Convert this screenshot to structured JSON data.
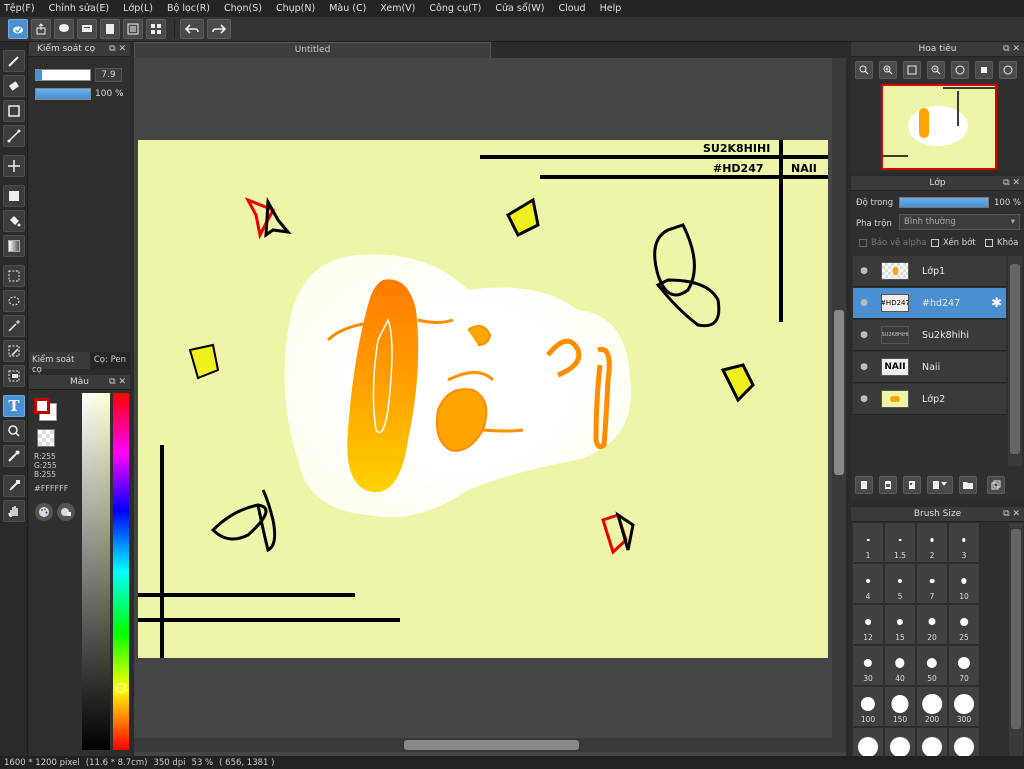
{
  "menu": [
    "Tệp(F)",
    "Chỉnh sửa(E)",
    "Lớp(L)",
    "Bộ lọc(R)",
    "Chọn(S)",
    "Chụp(N)",
    "Màu (C)",
    "Xem(V)",
    "Công cụ(T)",
    "Cửa sổ(W)",
    "Cloud",
    "Help"
  ],
  "canvas_tab": "Untitled",
  "brush_control": {
    "title": "Kiểm soát cọ",
    "size_value": "7.9",
    "opacity_value": "100 %",
    "size_level": 0.5,
    "opacity_level": 1.0
  },
  "tabs_left": {
    "tab1": "Kiểm soát cọ",
    "tab2": "Cọ: Pen"
  },
  "color_panel": {
    "title": "Màu",
    "r": "R:255",
    "g": "G:255",
    "b": "B:255",
    "hex": "#FFFFFF"
  },
  "navigator": {
    "title": "Hoa tiêu"
  },
  "layers": {
    "title": "Lớp",
    "opacity_label": "Độ trong",
    "opacity_value": "100 %",
    "blend_label": "Pha trộn",
    "blend_value": "Bình thường",
    "protect_alpha": "Bảo vệ alpha",
    "clipping": "Xén bớt",
    "lock": "Khóa",
    "items": [
      {
        "name": "Lớp1",
        "thumb": "",
        "selected": false
      },
      {
        "name": "#hd247",
        "thumb": "#HD247",
        "selected": true
      },
      {
        "name": "Su2k8hihi",
        "thumb": "SU2K8HIHI",
        "selected": false
      },
      {
        "name": "Naii",
        "thumb": "NAII",
        "selected": false
      },
      {
        "name": "Lớp2",
        "thumb": "",
        "selected": false
      }
    ]
  },
  "brush_size": {
    "title": "Brush Size",
    "sizes": [
      "1",
      "1.5",
      "2",
      "3",
      "4",
      "5",
      "7",
      "10",
      "12",
      "15",
      "20",
      "25",
      "30",
      "40",
      "50",
      "70",
      "100",
      "150",
      "200",
      "300",
      "",
      "",
      "",
      ""
    ]
  },
  "artwork": {
    "signature": "SU2K8HIHI",
    "hashtag": "#HD247",
    "name_tag": "NAII"
  },
  "status": {
    "dimensions": "1600 * 1200 pixel",
    "physical": "(11.6 * 8.7cm)",
    "dpi": "350 dpi",
    "zoom": "53 %",
    "coords": "( 656, 1381 )"
  },
  "colors": {
    "accent": "#4a8fd0",
    "canvas_bg": "#eff5a8",
    "fg_color": "#c00000"
  }
}
